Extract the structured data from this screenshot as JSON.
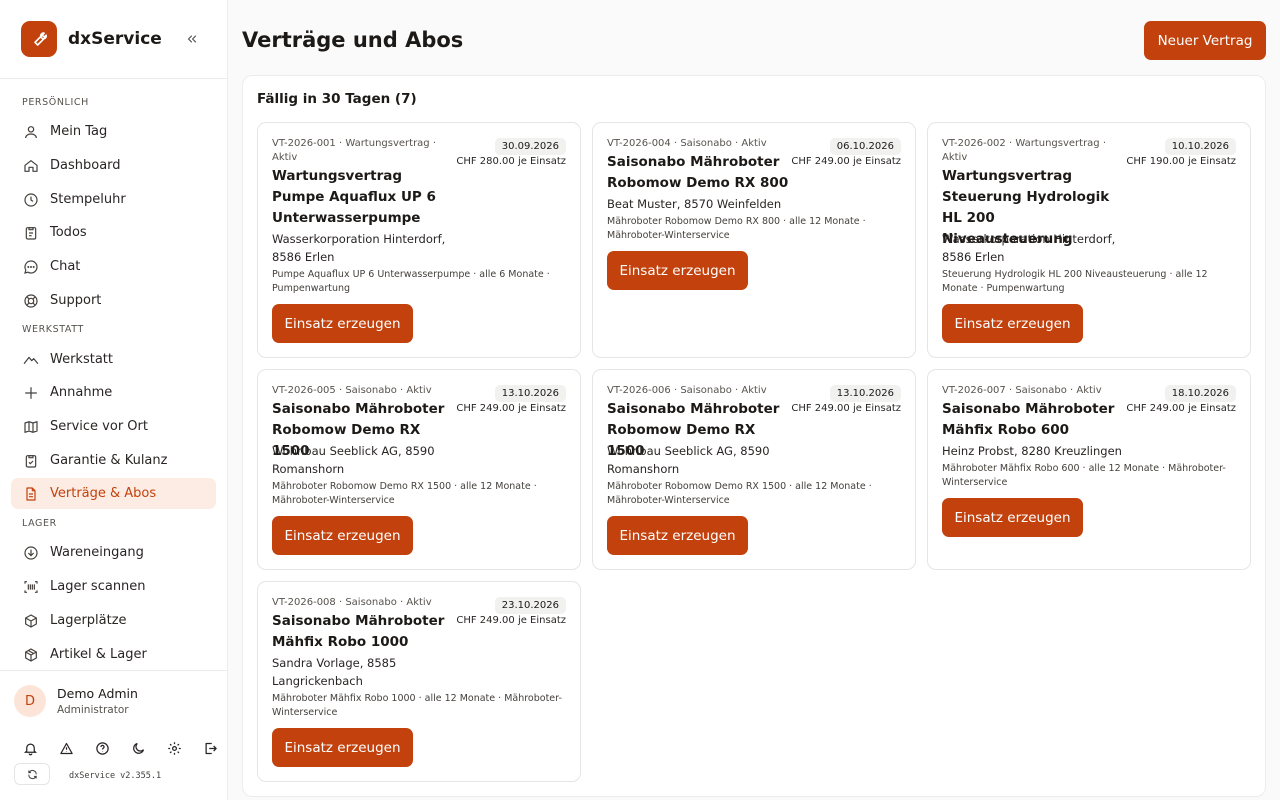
{
  "app": {
    "name": "dxService",
    "version": "dxService v2.355.1"
  },
  "sidebar": {
    "sections": [
      {
        "label": "PERSÖNLICH",
        "items": [
          {
            "label": "Mein Tag",
            "icon": "user-icon"
          },
          {
            "label": "Dashboard",
            "icon": "home-icon"
          },
          {
            "label": "Stempeluhr",
            "icon": "clock-icon"
          },
          {
            "label": "Todos",
            "icon": "clipboard-icon"
          },
          {
            "label": "Chat",
            "icon": "chat-icon"
          },
          {
            "label": "Support",
            "icon": "lifebuoy-icon"
          }
        ]
      },
      {
        "label": "WERKSTATT",
        "items": [
          {
            "label": "Werkstatt",
            "icon": "workshop-icon"
          },
          {
            "label": "Annahme",
            "icon": "plus-icon"
          },
          {
            "label": "Service vor Ort",
            "icon": "map-icon"
          },
          {
            "label": "Garantie & Kulanz",
            "icon": "clipboard-check-icon"
          },
          {
            "label": "Verträge & Abos",
            "icon": "document-icon",
            "active": true
          }
        ]
      },
      {
        "label": "LAGER",
        "items": [
          {
            "label": "Wareneingang",
            "icon": "download-icon"
          },
          {
            "label": "Lager scannen",
            "icon": "barcode-icon"
          },
          {
            "label": "Lagerplätze",
            "icon": "box-icon"
          },
          {
            "label": "Artikel & Lager",
            "icon": "package-icon"
          }
        ]
      }
    ]
  },
  "user": {
    "initial": "D",
    "name": "Demo Admin",
    "role": "Administrator"
  },
  "header": {
    "title": "Verträge und Abos",
    "new_button": "Neuer Vertrag"
  },
  "panel": {
    "title": "Fällig in 30 Tagen (7)"
  },
  "action_label": "Einsatz erzeugen",
  "contracts": [
    {
      "meta": "VT-2026-001 · Wartungsvertrag · Aktiv",
      "date": "30.09.2026",
      "price": "CHF 280.00 je Einsatz",
      "title": "Wartungsvertrag Pumpe Aquaflux UP 6 Unterwasserpumpe",
      "customer": "Wasserkorporation Hinterdorf, 8586 Erlen",
      "detail": "Pumpe Aquaflux UP 6 Unterwasserpumpe · alle 6 Monate · Pumpenwartung"
    },
    {
      "meta": "VT-2026-004 · Saisonabo · Aktiv",
      "date": "06.10.2026",
      "price": "CHF 249.00 je Einsatz",
      "title": "Saisonabo Mähroboter Robomow Demo RX 800",
      "customer": "Beat Muster, 8570 Weinfelden",
      "detail": "Mähroboter Robomow Demo RX 800 · alle 12 Monate · Mähroboter-Winterservice"
    },
    {
      "meta": "VT-2026-002 · Wartungsvertrag · Aktiv",
      "date": "10.10.2026",
      "price": "CHF 190.00 je Einsatz",
      "title": "Wartungsvertrag Steuerung Hydrologik HL 200 Niveausteuerung",
      "customer": "Wasserkorporation Hinterdorf, 8586 Erlen",
      "detail": "Steuerung Hydrologik HL 200 Niveausteuerung · alle 12 Monate · Pumpenwartung"
    },
    {
      "meta": "VT-2026-005 · Saisonabo · Aktiv",
      "date": "13.10.2026",
      "price": "CHF 249.00 je Einsatz",
      "title": "Saisonabo Mähroboter Robomow Demo RX 1500",
      "customer": "Wohnbau Seeblick AG, 8590 Romanshorn",
      "detail": "Mähroboter Robomow Demo RX 1500 · alle 12 Monate · Mähroboter-Winterservice"
    },
    {
      "meta": "VT-2026-006 · Saisonabo · Aktiv",
      "date": "13.10.2026",
      "price": "CHF 249.00 je Einsatz",
      "title": "Saisonabo Mähroboter Robomow Demo RX 1500",
      "customer": "Wohnbau Seeblick AG, 8590 Romanshorn",
      "detail": "Mähroboter Robomow Demo RX 1500 · alle 12 Monate · Mähroboter-Winterservice"
    },
    {
      "meta": "VT-2026-007 · Saisonabo · Aktiv",
      "date": "18.10.2026",
      "price": "CHF 249.00 je Einsatz",
      "title": "Saisonabo Mähroboter Mähfix Robo 600",
      "customer": "Heinz Probst, 8280 Kreuzlingen",
      "detail": "Mähroboter Mähfix Robo 600 · alle 12 Monate · Mähroboter-Winterservice"
    },
    {
      "meta": "VT-2026-008 · Saisonabo · Aktiv",
      "date": "23.10.2026",
      "price": "CHF 249.00 je Einsatz",
      "title": "Saisonabo Mähroboter Mähfix Robo 1000",
      "customer": "Sandra Vorlage, 8585 Langrickenbach",
      "detail": "Mähroboter Mähfix Robo 1000 · alle 12 Monate · Mähroboter-Winterservice"
    }
  ],
  "colors": {
    "accent": "#c2410c",
    "active_bg": "#fdece4"
  }
}
